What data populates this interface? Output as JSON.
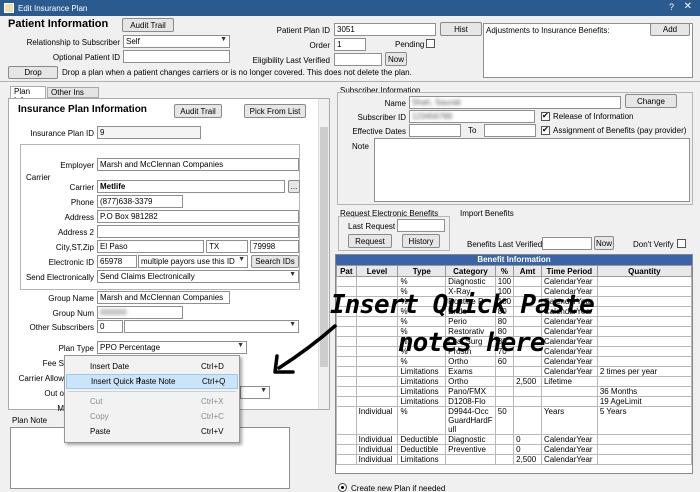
{
  "window": {
    "title": "Edit Insurance Plan",
    "help": "?",
    "close": "✕"
  },
  "header": {
    "title": "Patient Information",
    "audit_trail": "Audit Trail",
    "relationship_label": "Relationship to Subscriber",
    "relationship_value": "Self",
    "optional_id_label": "Optional Patient ID",
    "drop_btn": "Drop",
    "drop_text": "Drop a plan when a patient changes carriers or is no longer covered.  This does not delete the plan.",
    "plan_id_label": "Patient Plan ID",
    "plan_id_value": "3051",
    "hist_btn": "Hist",
    "order_label": "Order",
    "order_value": "1",
    "pending_label": "Pending",
    "elig_label": "Eligibility Last Verified",
    "now_btn": "Now",
    "adjust_label": "Adjustments to Insurance Benefits:",
    "add_btn": "Add"
  },
  "tabs": {
    "plan_info": "Plan Info",
    "other_ins": "Other Ins Info"
  },
  "plan": {
    "title": "Insurance Plan Information",
    "audit_trail": "Audit Trail",
    "pick_from_list": "Pick From List",
    "ins_plan_id_label": "Insurance Plan ID",
    "ins_plan_id_value": "9",
    "employer_label": "Employer",
    "employer_value": "Marsh and McClennan Companies",
    "carrier_group": "Carrier",
    "carrier_label": "Carrier",
    "carrier_value": "Metlife",
    "carrier_more": "...",
    "phone_label": "Phone",
    "phone_value": "(877)638-3379",
    "address_label": "Address",
    "address_value": "P.O Box 981282",
    "address2_label": "Address 2",
    "city_label": "City,ST,Zip",
    "city_value": "El Paso",
    "state_value": "TX",
    "zip_value": "79998",
    "eid_label": "Electronic ID",
    "eid_value": "65978",
    "eid_combo": "multiple payors use this ID",
    "search_ids": "Search IDs",
    "send_label": "Send Electronically",
    "send_value": "Send Claims Electronically",
    "group_name_label": "Group Name",
    "group_name_value": "Marsh and McClennan Companies",
    "group_num_label": "Group Num",
    "other_subs_label": "Other Subscribers",
    "other_subs_value": "0",
    "plan_type_label": "Plan Type",
    "plan_type_value": "PPO Percentage",
    "fee_label": "Fee S",
    "carrier_allow_label": "Carrier Allow",
    "out_label": "Out o",
    "m_label": "M"
  },
  "plan_note": {
    "label": "Plan Note"
  },
  "subscriber": {
    "title": "Subscriber Information",
    "name_label": "Name",
    "change_btn": "Change",
    "sub_id_label": "Subscriber ID",
    "release_label": "Release of Information",
    "eff_label": "Effective Dates",
    "to_label": "To",
    "assign_label": "Assignment of Benefits (pay provider)",
    "note_label": "Note"
  },
  "request": {
    "title": "Request Electronic Benefits",
    "last_label": "Last Request",
    "request_btn": "Request",
    "history_btn": "History"
  },
  "import": {
    "title": "Import Benefits",
    "last_verified_label": "Benefits Last Verified",
    "now_btn": "Now",
    "dont_verify": "Don't Verify"
  },
  "benefits": {
    "title": "Benefit Information",
    "columns": [
      "Pat",
      "Level",
      "Type",
      "Category",
      "%",
      "Amt",
      "Time Period",
      "Quantity"
    ],
    "rows": [
      [
        "",
        "",
        "%",
        "Diagnostic",
        "100",
        "",
        "CalendarYear",
        ""
      ],
      [
        "",
        "",
        "%",
        "X-Ray",
        "100",
        "",
        "CalendarYear",
        ""
      ],
      [
        "",
        "",
        "%",
        "Routine P",
        "100",
        "",
        "CalendarYear",
        ""
      ],
      [
        "",
        "",
        "%",
        "Endo",
        "80",
        "",
        "CalendarYear",
        ""
      ],
      [
        "",
        "",
        "%",
        "Perio",
        "80",
        "",
        "CalendarYear",
        ""
      ],
      [
        "",
        "",
        "%",
        "Restorativ",
        "80",
        "",
        "CalendarYear",
        ""
      ],
      [
        "",
        "",
        "%",
        "Oral Surg",
        "80",
        "",
        "CalendarYear",
        ""
      ],
      [
        "",
        "",
        "%",
        "Prosth",
        "70",
        "",
        "CalendarYear",
        ""
      ],
      [
        "",
        "",
        "%",
        "Ortho",
        "60",
        "",
        "CalendarYear",
        ""
      ],
      [
        "",
        "",
        "Limitations",
        "Exams",
        "",
        "",
        "CalendarYear",
        "2 times per year"
      ],
      [
        "",
        "",
        "Limitations",
        "Ortho",
        "",
        "2,500",
        "Lifetime",
        ""
      ],
      [
        "",
        "",
        "Limitations",
        "Pano/FMX",
        "",
        "",
        "",
        "36 Months"
      ],
      [
        "",
        "",
        "Limitations",
        "D1208-Flo",
        "",
        "",
        "",
        "19 AgeLimit"
      ],
      [
        "",
        "Individual",
        "%",
        "D9944-OccGuardHardFull",
        "50",
        "",
        "Years",
        "5 Years"
      ],
      [
        "",
        "Individual",
        "Deductible",
        "Diagnostic",
        "",
        "0",
        "CalendarYear",
        ""
      ],
      [
        "",
        "Individual",
        "Deductible",
        "Preventive",
        "",
        "0",
        "CalendarYear",
        ""
      ],
      [
        "",
        "Individual",
        "Limitations",
        "",
        "",
        "2,500",
        "CalendarYear",
        ""
      ]
    ]
  },
  "footer": {
    "create_new": "Create new Plan if needed"
  },
  "context_menu": {
    "items": [
      {
        "label": "Insert Date",
        "shortcut": "Ctrl+D",
        "enabled": true
      },
      {
        "label": "Insert Quick Paste Note",
        "shortcut": "Ctrl+Q",
        "enabled": true
      },
      {
        "label": "Cut",
        "shortcut": "Ctrl+X",
        "enabled": false
      },
      {
        "label": "Copy",
        "shortcut": "Ctrl+C",
        "enabled": false
      },
      {
        "label": "Paste",
        "shortcut": "Ctrl+V",
        "enabled": true
      }
    ]
  },
  "annotation": {
    "line1": "Insert Quick Paste",
    "line2": "notes here"
  },
  "colors": {
    "title_bar": "#2b5a8f",
    "benefit_header": "#3a63a8",
    "highlight": "#cce4f7"
  }
}
